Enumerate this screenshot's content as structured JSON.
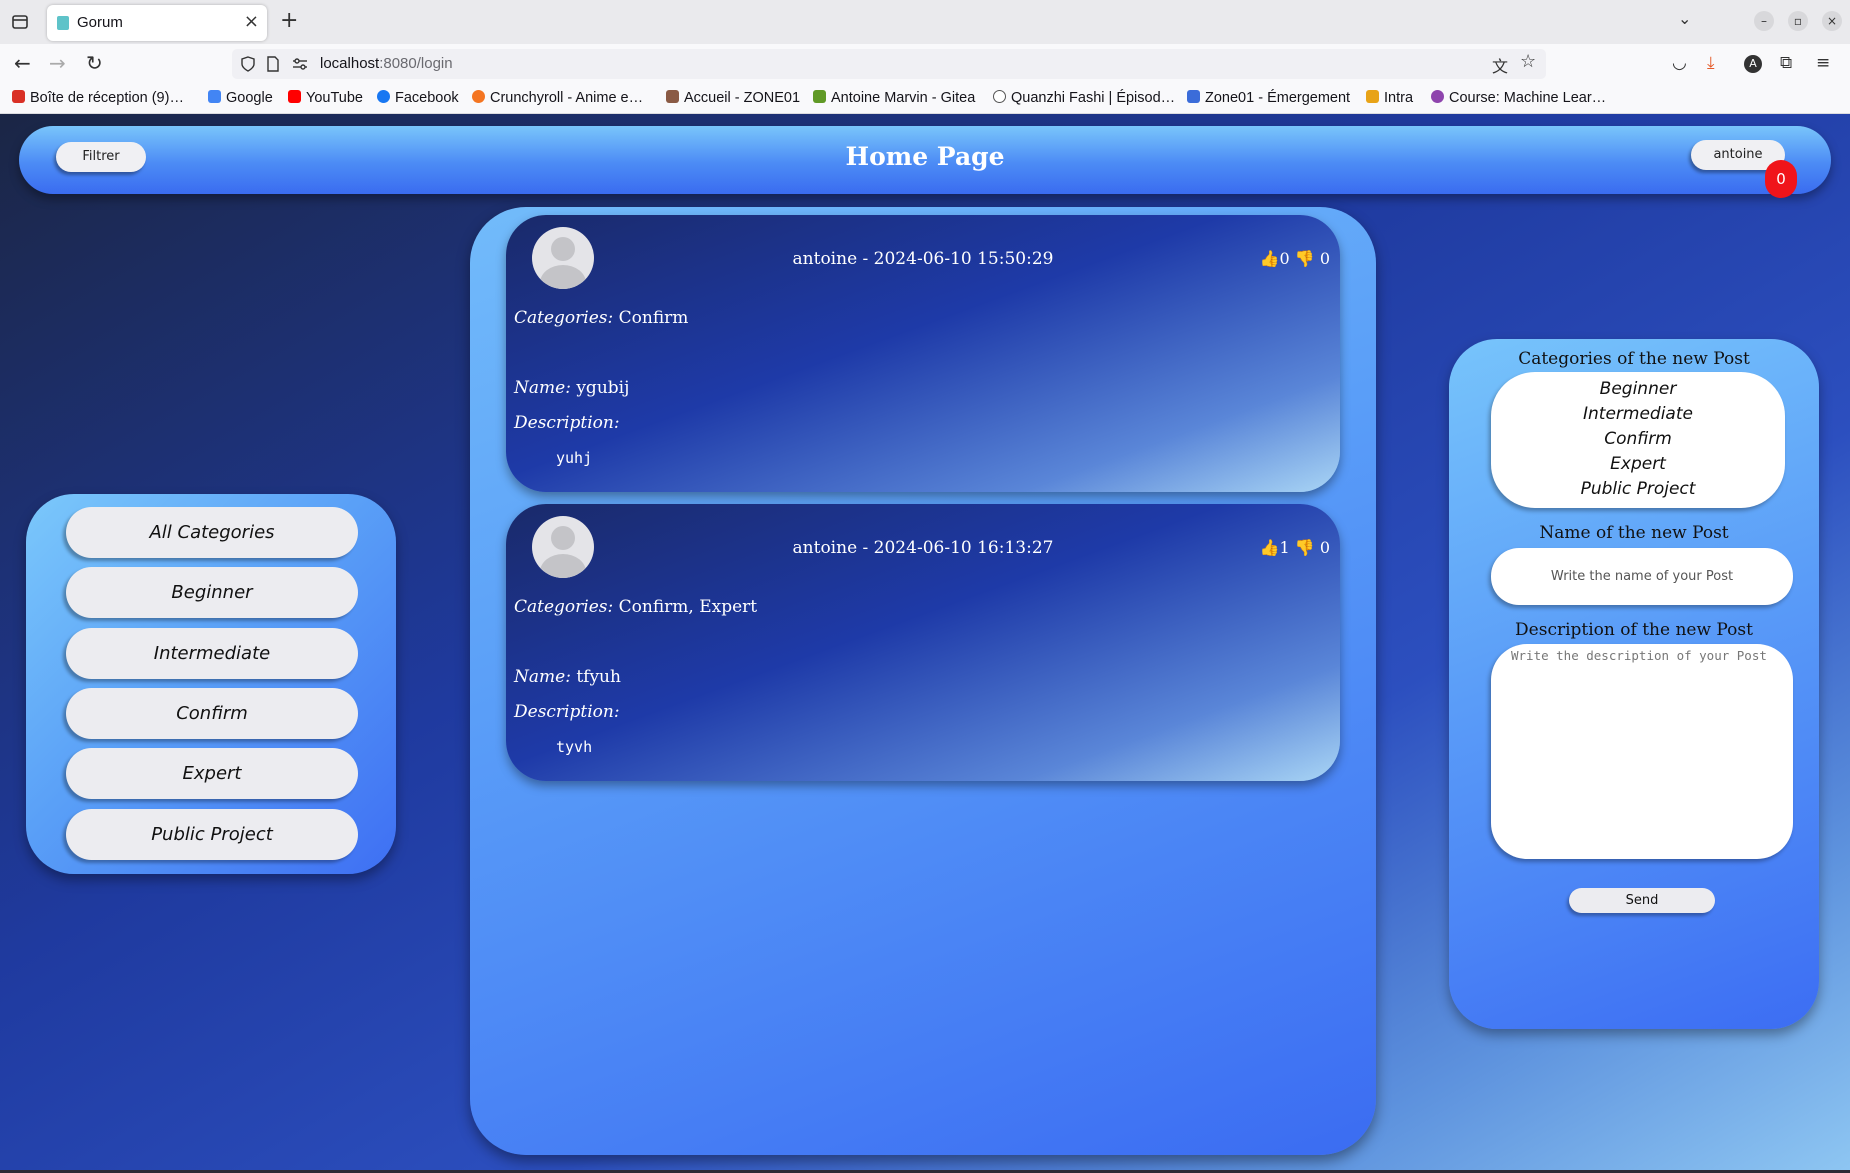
{
  "browser": {
    "tab_title": "Gorum",
    "url_host": "localhost",
    "url_path": ":8080/login",
    "bookmarks": [
      {
        "label": "Boîte de réception (9)…",
        "color": "#d93025"
      },
      {
        "label": "Google",
        "color": "#4285f4"
      },
      {
        "label": "YouTube",
        "color": "#ff0000"
      },
      {
        "label": "Facebook",
        "color": "#1877f2"
      },
      {
        "label": "Crunchyroll - Anime e…",
        "color": "#f47521"
      },
      {
        "label": "Accueil - ZONE01",
        "color": "#8a5a44"
      },
      {
        "label": "Antoine Marvin - Gitea",
        "color": "#609926"
      },
      {
        "label": "Quanzhi Fashi | Épisod…",
        "color": "#555555"
      },
      {
        "label": "Zone01 - Émergement",
        "color": "#3b6cd9"
      },
      {
        "label": "Intra",
        "color": "#e8a317"
      },
      {
        "label": "Course: Machine Lear…",
        "color": "#8e44ad"
      }
    ]
  },
  "header": {
    "title": "Home Page",
    "filter_label": "Filtrer",
    "username": "antoine",
    "notification_count": "0"
  },
  "categories_sidebar": {
    "items": [
      "All Categories",
      "Beginner",
      "Intermediate",
      "Confirm",
      "Expert",
      "Public Project"
    ]
  },
  "posts": [
    {
      "meta": "antoine - 2024-06-10 15:50:29",
      "likes": "0",
      "dislikes": "0",
      "categories_label": "Categories:",
      "categories": "Confirm",
      "name_label": "Name:",
      "name": "ygubij",
      "description_label": "Description:",
      "description": "yuhj"
    },
    {
      "meta": "antoine - 2024-06-10 16:13:27",
      "likes": "1",
      "dislikes": "0",
      "categories_label": "Categories:",
      "categories": "Confirm, Expert",
      "name_label": "Name:",
      "name": "tfyuh",
      "description_label": "Description:",
      "description": "tyvh"
    }
  ],
  "new_post": {
    "categories_title": "Categories of the new Post",
    "categories": [
      "Beginner",
      "Intermediate",
      "Confirm",
      "Expert",
      "Public Project"
    ],
    "name_title": "Name of the new Post",
    "name_placeholder": "Write the name of your Post",
    "description_title": "Description of the new Post",
    "description_placeholder": "Write the description of your Post",
    "send_label": "Send"
  },
  "colors": {
    "accent": "#3b6cf2",
    "notification": "#f0141a"
  }
}
